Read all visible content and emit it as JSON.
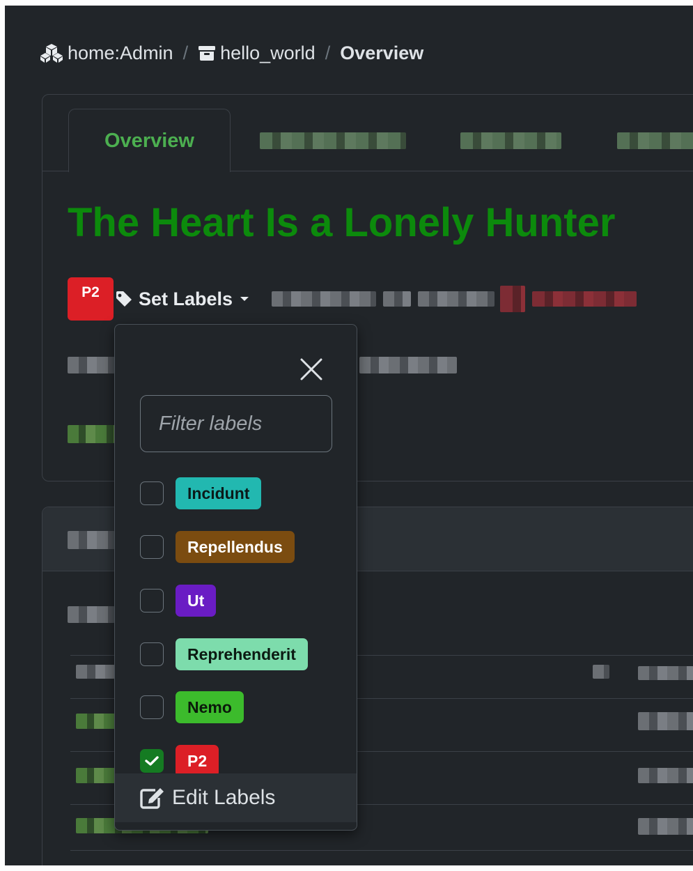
{
  "breadcrumb": {
    "project": "home:Admin",
    "package": "hello_world",
    "separator": "/",
    "current": "Overview"
  },
  "tabs": {
    "active_label": "Overview"
  },
  "package": {
    "title": "The Heart Is a Lonely Hunter"
  },
  "labels_bar": {
    "current_badge": "P2",
    "set_labels": "Set Labels"
  },
  "label_dropdown": {
    "filter_placeholder": "Filter labels",
    "options": [
      {
        "name": "Incidunt",
        "color": "#22b8b0",
        "text_color": "#0b1a1a",
        "checked": false
      },
      {
        "name": "Repellendus",
        "color": "#7b4c10",
        "text_color": "#ffffff",
        "checked": false
      },
      {
        "name": "Ut",
        "color": "#6a1cc4",
        "text_color": "#ffffff",
        "checked": false
      },
      {
        "name": "Reprehenderit",
        "color": "#7ddcac",
        "text_color": "#0b1a12",
        "checked": false
      },
      {
        "name": "Nemo",
        "color": "#3cbb2c",
        "text_color": "#0b1a0b",
        "checked": false
      },
      {
        "name": "P2",
        "color": "#dc1f26",
        "text_color": "#ffffff",
        "checked": true
      }
    ],
    "edit_labels": "Edit Labels"
  },
  "colors": {
    "accent_green": "#4caf50",
    "title_green": "#0c8a0c",
    "danger": "#dc1f26",
    "background": "#212529"
  }
}
